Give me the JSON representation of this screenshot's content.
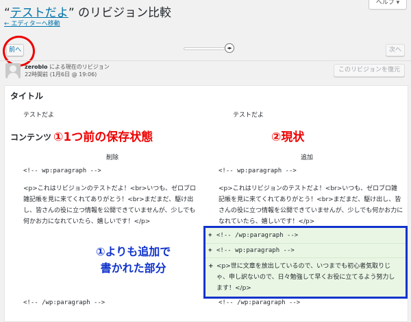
{
  "header": {
    "title_quote_open": "“",
    "title_link": "テストだよ",
    "title_rest": "” のリビジョン比較",
    "back_link": "← エディターへ移動",
    "help_label": "ヘルプ ▾"
  },
  "nav": {
    "prev_label": "前へ",
    "next_label": "次へ",
    "slider_handle_glyph": "◂▸"
  },
  "revision": {
    "author": "zeroblo",
    "author_suffix": " による現在のリビジョン",
    "timestamp": "22時間前 (1月6日 @ 19:06)",
    "restore_label": "このリビジョンを復元"
  },
  "diff": {
    "title_label": "タイトル",
    "title_left": "テストだよ",
    "title_right": "テストだよ",
    "content_label": "コンテンツ",
    "removed_header": "削除",
    "added_header": "追加",
    "line1_left": "<!-- wp:paragraph -->",
    "line1_right": "<!-- wp:paragraph -->",
    "para_left": "<p>これはリビジョンのテストだよ！<br>いつも、ゼロブロ雑記帳を見に来てくれてありがとう！<br>まだまだ、駆け出し、皆さんの役に立つ情報を公開できていませんが、少しでも何かお力になれていたら、嬉しいです！</p>",
    "para_right": "<p>これはリビジョンのテストだよ！<br>いつも、ゼロブロ雑記帳を見に来てくれてありがとう！<br>まだまだ、駆け出し、皆さんの役に立つ情報を公開できていませんが、少しでも何かお力になれていたら、嬉しいです！</p>",
    "added": [
      {
        "sign": "+",
        "text": "<!-- /wp:paragraph -->"
      },
      {
        "sign": "+",
        "text": "<!-- wp:paragraph -->"
      },
      {
        "sign": "+",
        "text": "<p>世に文章を放出しているので、いつまでも初心者気取りじゃ、申し訳ないので、日々勉強して早くお役に立てるよう努力します！</p>"
      }
    ],
    "line3_left": "<!-- /wp:paragraph -->",
    "line3_right": "<!-- /wp:paragraph -->"
  },
  "annotations": {
    "left": "①1つ前の保存状態",
    "right": "②現状",
    "blue_line1": "①よりも追加で",
    "blue_line2": "書かれた部分"
  },
  "colors": {
    "annotation_red": "#ee0000",
    "annotation_blue": "#1133cc",
    "added_bg": "#e9f6e4",
    "link": "#0073aa"
  }
}
